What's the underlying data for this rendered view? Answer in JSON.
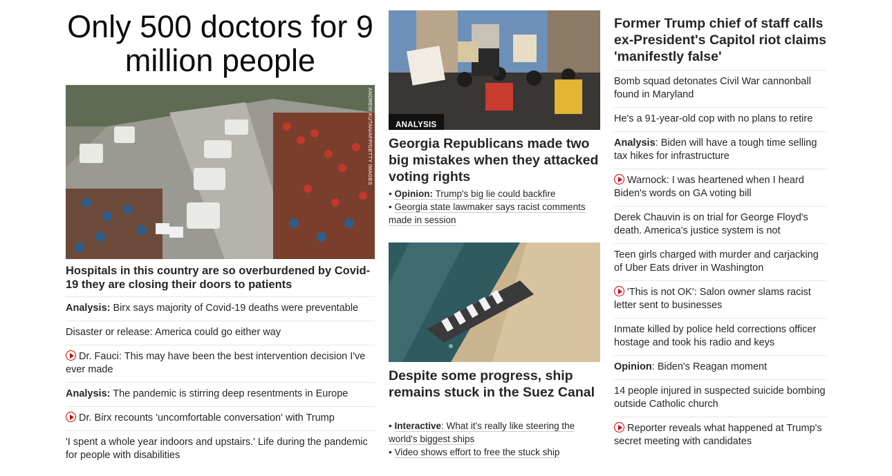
{
  "left": {
    "headline": "Only 500 doctors for 9 million people",
    "image_credit": "ANDREW KUTAN/AFP/GETTY IMAGES",
    "story_headline": "Hospitals in this country are so overburdened by Covid-19 they are closing their doors to patients",
    "items": [
      {
        "prefix": "Analysis:",
        "text": " Birx says majority of Covid-19 deaths were preventable",
        "video": false
      },
      {
        "prefix": "",
        "text": "Disaster or release: America could go either way",
        "video": false
      },
      {
        "prefix": "",
        "text": "Dr. Fauci: This may have been the best intervention decision I've ever made",
        "video": true
      },
      {
        "prefix": "Analysis:",
        "text": " The pandemic is stirring deep resentments in Europe",
        "video": false
      },
      {
        "prefix": "",
        "text": "Dr. Birx recounts 'uncomfortable conversation' with Trump",
        "video": true
      },
      {
        "prefix": "",
        "text": "'I spent a whole year indoors and upstairs.' Life during the pandemic for people with disabilities",
        "video": false
      }
    ]
  },
  "middle": {
    "story1": {
      "tag": "ANALYSIS",
      "headline": "Georgia Republicans made two big mistakes when they attacked voting rights",
      "sub1_prefix": "Opinion:",
      "sub1_text": " Trump's big lie could backfire",
      "sub2_text": "Georgia state lawmaker says racist comments made in session"
    },
    "story2": {
      "headline": "Despite some progress, ship remains stuck in the Suez Canal",
      "sub1_prefix": "Interactive",
      "sub1_text": ": What it's really like steering the world's biggest ships",
      "sub2_text": "Video shows effort to free the stuck ship"
    }
  },
  "right": {
    "headline": "Former Trump chief of staff calls ex-President's Capitol riot claims 'manifestly false'",
    "items": [
      {
        "prefix": "",
        "text": "Bomb squad detonates Civil War cannonball found in Maryland",
        "video": false
      },
      {
        "prefix": "",
        "text": "He's a 91-year-old cop with no plans to retire",
        "video": false
      },
      {
        "prefix": "Analysis",
        "text": ": Biden will have a tough time selling tax hikes for infrastructure",
        "video": false
      },
      {
        "prefix": "",
        "text": "Warnock: I was heartened when I heard Biden's words on GA voting bill",
        "video": true
      },
      {
        "prefix": "",
        "text": "Derek Chauvin is on trial for George Floyd's death. America's justice system is not",
        "video": false
      },
      {
        "prefix": "",
        "text": "Teen girls charged with murder and carjacking of Uber Eats driver in Washington",
        "video": false
      },
      {
        "prefix": "",
        "text": "'This is not OK': Salon owner slams racist letter sent to businesses",
        "video": true
      },
      {
        "prefix": "",
        "text": "Inmate killed by police held corrections officer hostage and took his radio and keys",
        "video": false
      },
      {
        "prefix": "Opinion",
        "text": ": Biden's Reagan moment",
        "video": false
      },
      {
        "prefix": "",
        "text": "14 people injured in suspected suicide bombing outside Catholic church",
        "video": false
      },
      {
        "prefix": "",
        "text": "Reporter reveals what happened at Trump's secret meeting with candidates",
        "video": true
      }
    ]
  },
  "colors": {
    "accent_red": "#cc0000",
    "text": "#262626",
    "divider": "#e6e6e6"
  }
}
